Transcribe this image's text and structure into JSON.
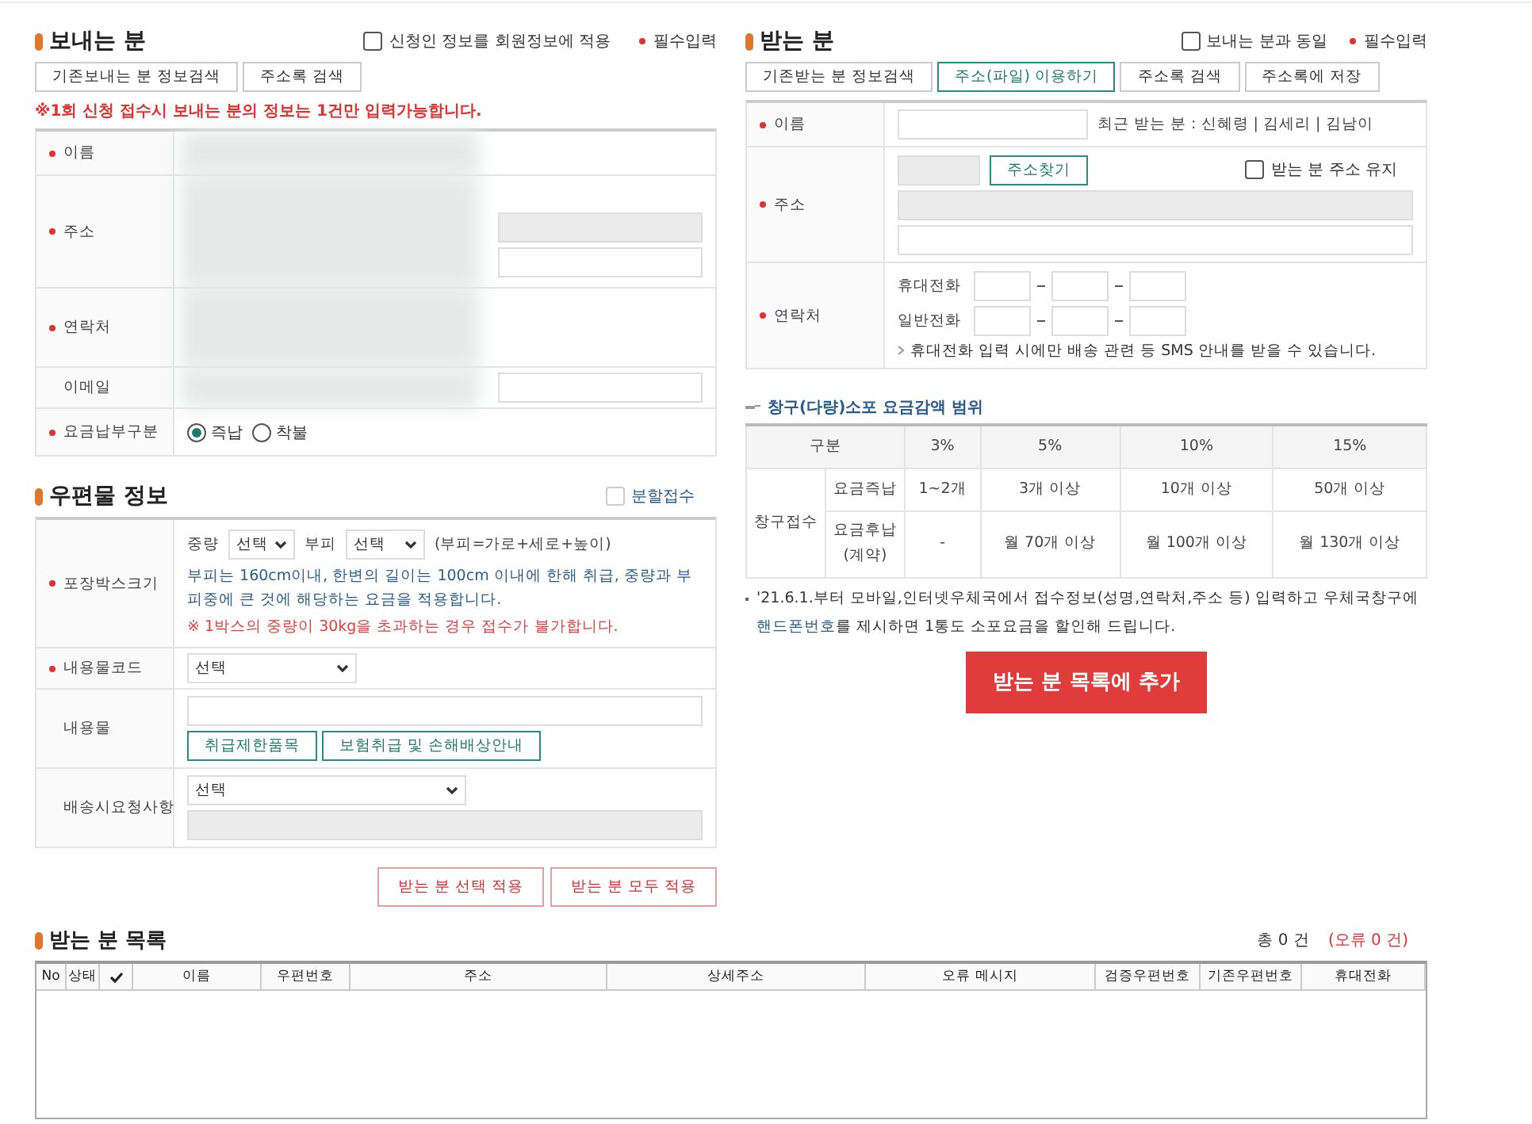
{
  "sender": {
    "title": "보내는 분",
    "apply_member": {
      "label": "신청인 정보를 회원정보에 적용",
      "checked": false
    },
    "required_note": "필수입력",
    "buttons": [
      "기존보내는 분 정보검색",
      "주소록 검색"
    ],
    "warning": "※1회 신청 접수시 보내는 분의 정보는 1건만 입력가능합니다.",
    "rows": [
      {
        "kind": "name",
        "label": "이름",
        "required": true
      },
      {
        "kind": "address",
        "label": "주소",
        "required": true
      },
      {
        "kind": "contact",
        "label": "연락처",
        "required": true
      },
      {
        "kind": "email",
        "label": "이메일",
        "required": false
      },
      {
        "kind": "payment",
        "label": "요금납부구분",
        "required": true,
        "options": [
          {
            "label": "즉납",
            "selected": true
          },
          {
            "label": "착불",
            "selected": false
          }
        ]
      }
    ]
  },
  "mail": {
    "title": "우편물 정보",
    "split": {
      "label": "분할접수",
      "checked": false
    },
    "rows": [
      {
        "kind": "box",
        "label": "포장박스크기",
        "required": true,
        "weight_label": "중량",
        "weight_value": "선택",
        "volume_label": "부피",
        "volume_value": "선택",
        "formula": "(부피=가로+세로+높이)",
        "info": "부피는 160cm이내, 한변의 길이는 100cm 이내에 한해 취급, 중량과 부피중에 큰 것에 해당하는 요금을 적용합니다.",
        "warning": "※ 1박스의 중량이 30kg을 초과하는 경우 접수가 불가합니다."
      },
      {
        "kind": "code",
        "label": "내용물코드",
        "required": true,
        "value": "선택"
      },
      {
        "kind": "contents",
        "label": "내용물",
        "required": false,
        "buttons": [
          "취급제한품목",
          "보험취급 및 손해배상안내"
        ]
      },
      {
        "kind": "request",
        "label": "배송시요청사항",
        "required": false,
        "value": "선택"
      }
    ],
    "apply_buttons": [
      "받는 분 선택 적용",
      "받는 분 모두 적용"
    ]
  },
  "recipient": {
    "title": "받는 분",
    "same_as_sender": {
      "label": "보내는 분과 동일",
      "checked": false
    },
    "required_note": "필수입력",
    "buttons": [
      {
        "label": "기존받는 분 정보검색",
        "emphasized": false
      },
      {
        "label": "주소(파일) 이용하기",
        "emphasized": true
      },
      {
        "label": "주소록 검색",
        "emphasized": false
      },
      {
        "label": "주소록에 저장",
        "emphasized": false
      }
    ],
    "rows": [
      {
        "kind": "name",
        "label": "이름",
        "required": true,
        "recent": "최근 받는 분 : 신혜령 | 김세리 | 김남이"
      },
      {
        "kind": "address",
        "label": "주소",
        "required": true,
        "search_button": "주소찾기",
        "keep": {
          "label": "받는 분 주소 유지",
          "checked": false
        }
      },
      {
        "kind": "contact",
        "label": "연락처",
        "required": true,
        "phones": [
          {
            "label": "휴대전화"
          },
          {
            "label": "일반전화"
          }
        ],
        "hint": "휴대전화 입력 시에만 배송 관련 등 SMS 안내를 받을 수 있습니다."
      }
    ]
  },
  "discount": {
    "title": "창구(다량)소포 요금감액 범위",
    "header": [
      "구분",
      "3%",
      "5%",
      "10%",
      "15%"
    ],
    "group": "창구접수",
    "rows": [
      {
        "label": "요금즉납",
        "cells": [
          "1~2개",
          "3개 이상",
          "10개 이상",
          "50개 이상"
        ]
      },
      {
        "label": "요금후납\n(계약)",
        "cells": [
          "-",
          "월 70개 이상",
          "월 100개 이상",
          "월 130개 이상"
        ]
      }
    ],
    "note": {
      "before": "'21.6.1.부터 모바일,인터넷우체국에서 접수정보(성명,연락처,주소 등) 입력하고 우체국창구에 ",
      "link": "핸드폰번호",
      "after": "를 제시하면 1통도 소포요금을 할인해 드립니다."
    }
  },
  "add_button": "받는 분 목록에 추가",
  "list": {
    "title": "받는 분 목록",
    "total": "총 0 건",
    "errors": "(오류 0 건)",
    "columns": [
      {
        "kind": "text",
        "label": "No"
      },
      {
        "kind": "text",
        "label": "상태"
      },
      {
        "kind": "check"
      },
      {
        "kind": "text",
        "label": "이름"
      },
      {
        "kind": "text",
        "label": "우편번호"
      },
      {
        "kind": "text",
        "label": "주소"
      },
      {
        "kind": "text",
        "label": "상세주소"
      },
      {
        "kind": "text",
        "label": "오류 메시지"
      },
      {
        "kind": "text",
        "label": "검증우편번호"
      },
      {
        "kind": "text",
        "label": "기존우편번호"
      },
      {
        "kind": "text",
        "label": "휴대전화"
      }
    ]
  }
}
